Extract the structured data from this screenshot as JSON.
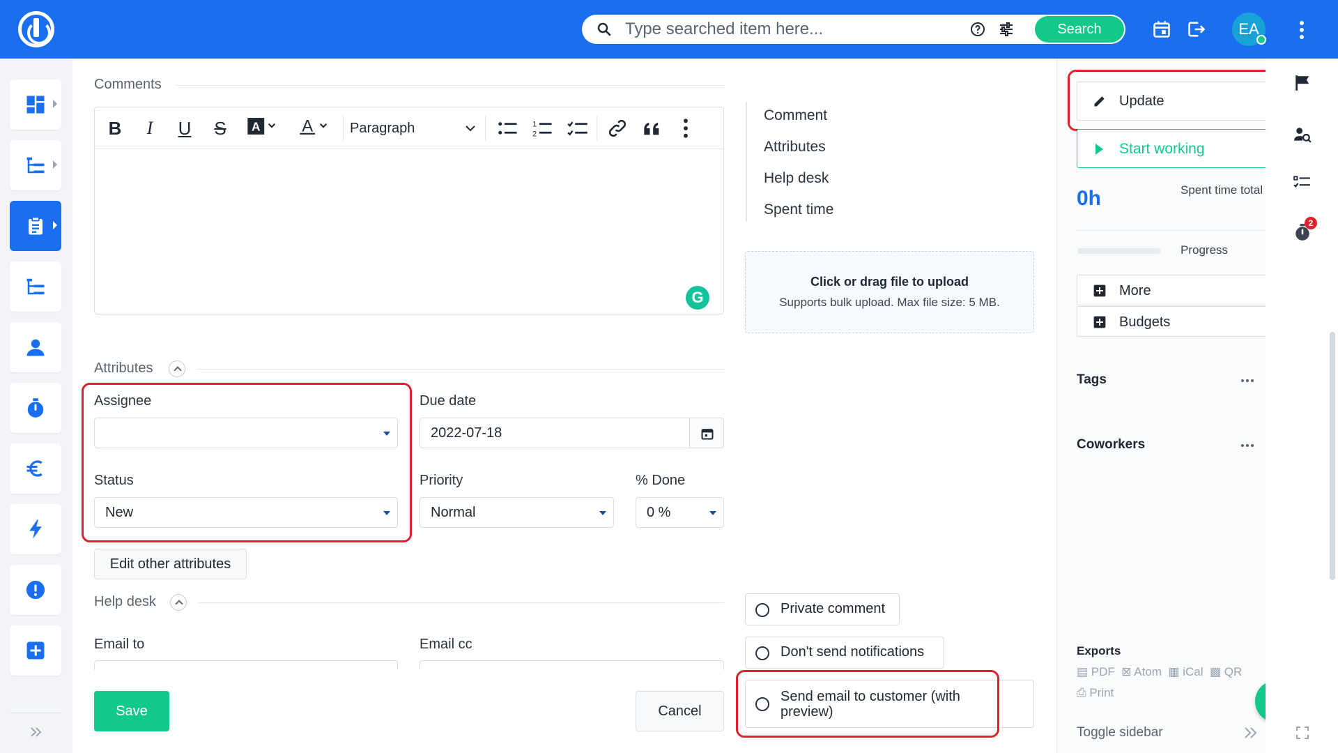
{
  "header": {
    "search_placeholder": "Type searched item here...",
    "search_button": "Search",
    "avatar_initials": "EA",
    "brand_color": "#1a6ff0",
    "accent_color": "#12c98a"
  },
  "leftnav": {
    "items": [
      {
        "icon": "dashboard-icon"
      },
      {
        "icon": "project-tree-icon"
      },
      {
        "icon": "tasks-clipboard-icon",
        "active": true
      },
      {
        "icon": "hierarchy-icon"
      },
      {
        "icon": "user-icon"
      },
      {
        "icon": "stopwatch-icon"
      },
      {
        "icon": "euro-icon"
      },
      {
        "icon": "lightning-icon"
      },
      {
        "icon": "alert-icon"
      },
      {
        "icon": "add-icon"
      }
    ]
  },
  "comments": {
    "section_title": "Comments",
    "toolbar": {
      "bold": "B",
      "italic": "I",
      "underline": "U",
      "strike": "S",
      "paragraph": "Paragraph"
    }
  },
  "side_tabs": [
    "Comment",
    "Attributes",
    "Help desk",
    "Spent time"
  ],
  "upload": {
    "title": "Click or drag file to upload",
    "subtitle": "Supports bulk upload. Max file size: 5 MB."
  },
  "attributes": {
    "section_title": "Attributes",
    "assignee_label": "Assignee",
    "assignee_value": "",
    "due_date_label": "Due date",
    "due_date_value": "2022-07-18",
    "status_label": "Status",
    "status_value": "New",
    "priority_label": "Priority",
    "priority_value": "Normal",
    "done_label": "% Done",
    "done_value": "0 %",
    "edit_other": "Edit other attributes"
  },
  "helpdesk": {
    "section_title": "Help desk",
    "email_to_label": "Email to",
    "email_cc_label": "Email cc"
  },
  "options": {
    "private_comment": "Private comment",
    "dont_send": "Don't send notifications",
    "send_email": "Send email to customer (with preview)"
  },
  "actions": {
    "save": "Save",
    "cancel": "Cancel"
  },
  "sidebar": {
    "update": "Update",
    "start_working": "Start working",
    "spent_value": "0h",
    "spent_label": "Spent time total",
    "progress_label": "Progress",
    "progress_fraction": 0,
    "more": "More",
    "budgets": "Budgets",
    "tags": "Tags",
    "coworkers": "Coworkers",
    "exports_title": "Exports",
    "exports": [
      "PDF",
      "Atom",
      "iCal",
      "QR"
    ],
    "print": "Print",
    "toggle_sidebar": "Toggle sidebar"
  },
  "rail": {
    "badge_count": "2"
  }
}
